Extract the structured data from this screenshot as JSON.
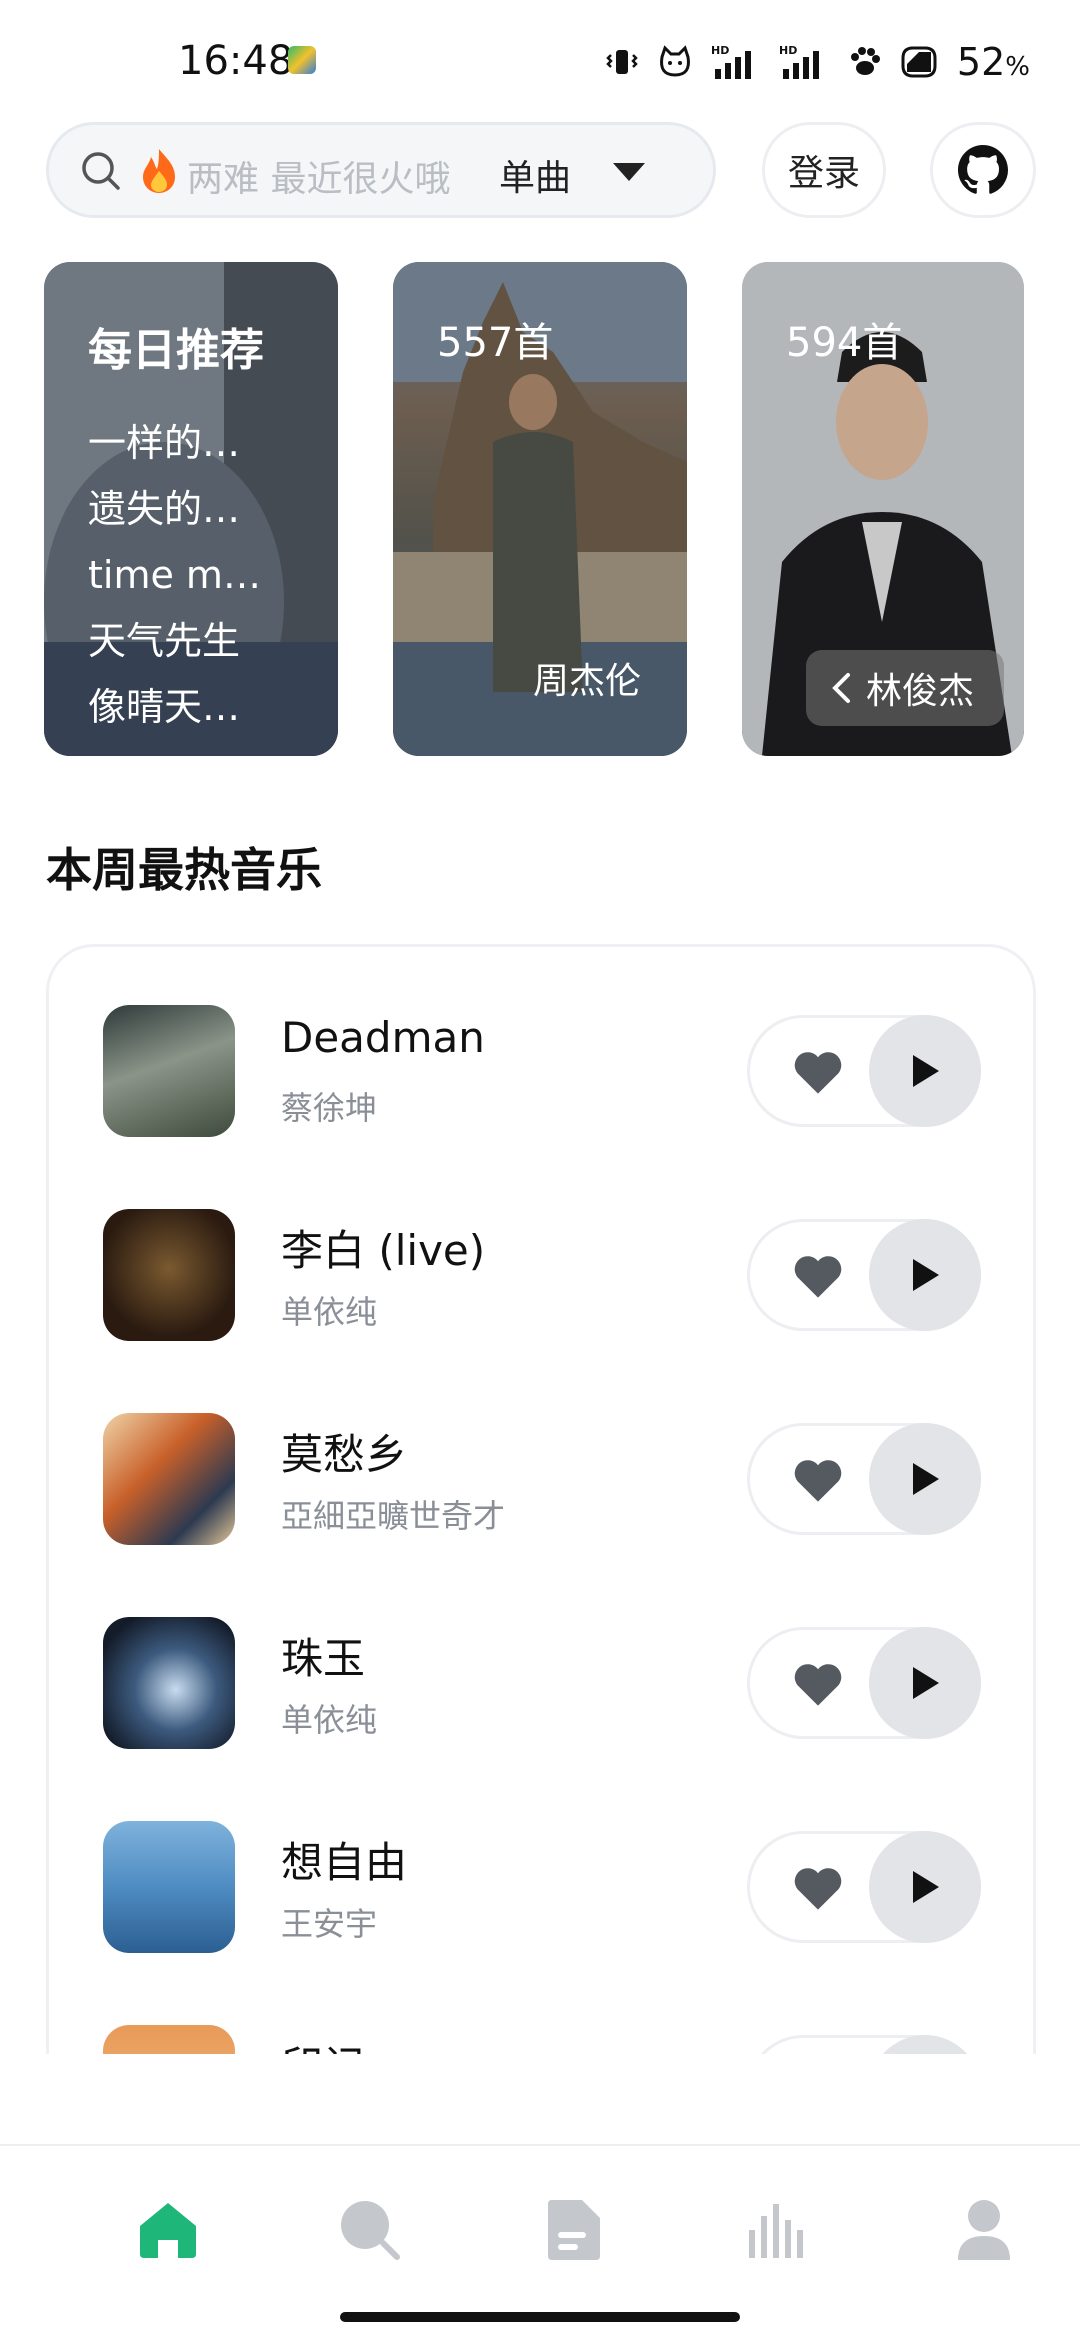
{
  "status_bar": {
    "time": "16:48",
    "battery_percent": "52",
    "battery_unit": "%",
    "icons": [
      "app-icon",
      "vibrate-icon",
      "cat-icon",
      "hd-signal-icon",
      "hd-signal-icon",
      "paw-icon",
      "battery-icon"
    ]
  },
  "search": {
    "placeholder": "两难 最近很火哦",
    "type_label": "单曲",
    "login_label": "登录",
    "github_icon": "github-icon"
  },
  "cards": {
    "daily": {
      "title": "每日推荐",
      "items": [
        "一样的…",
        "遗失的…",
        "time m…",
        "天气先生",
        "像晴天…"
      ]
    },
    "artist1": {
      "count": "557首",
      "name": "周杰伦"
    },
    "artist2": {
      "count": "594首",
      "name": "林俊杰"
    }
  },
  "section": {
    "title": "本周最热音乐"
  },
  "songs": [
    {
      "title": "Deadman",
      "artist": "蔡徐坤",
      "cover_color": "#556052"
    },
    {
      "title": "李白 (live)",
      "artist": "单依纯",
      "cover_color": "#3a2a1c"
    },
    {
      "title": "莫愁乡",
      "artist": "亞細亞曠世奇才",
      "cover_color": "#d79a5a"
    },
    {
      "title": "珠玉",
      "artist": "单依纯",
      "cover_color": "#22344a"
    },
    {
      "title": "想自由",
      "artist": "王安宇",
      "cover_color": "#4f8cc0"
    },
    {
      "title": "印记",
      "artist": "",
      "cover_color": "#e8a060"
    }
  ],
  "nav": {
    "items": [
      "home-icon",
      "search-icon",
      "document-icon",
      "chart-icon",
      "user-icon"
    ],
    "active": "home-icon",
    "active_color": "#1fb679",
    "inactive_color": "#c4c7cc"
  }
}
